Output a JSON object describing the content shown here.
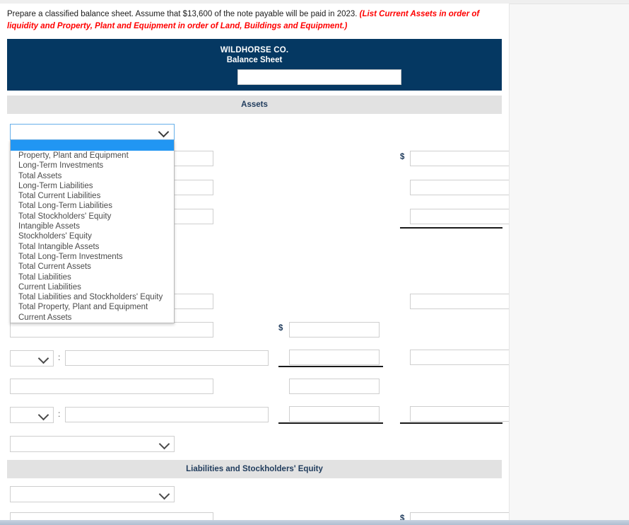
{
  "instructions": {
    "text": "Prepare a classified balance sheet. Assume that $13,600 of the note payable will be paid in 2023. ",
    "hint": "(List Current Assets in order of liquidity and Property, Plant and Equipment in order of Land, Buildings and Equipment.)"
  },
  "sheet": {
    "company": "WILDHORSE CO.",
    "title": "Balance Sheet",
    "period_value": "",
    "period_placeholder": ""
  },
  "sections": {
    "assets": "Assets",
    "liabilities_equity": "Liabilities and Stockholders' Equity"
  },
  "dropdown": {
    "selected": "",
    "options": [
      "",
      "Property, Plant and Equipment",
      "Long-Term Investments",
      "Total Assets",
      "Long-Term Liabilities",
      "Total Current Liabilities",
      "Total Long-Term Liabilities",
      "Total Stockholders' Equity",
      "Intangible Assets",
      "Stockholders' Equity",
      "Total Intangible Assets",
      "Total Long-Term Investments",
      "Total Current Assets",
      "Total Liabilities",
      "Current Liabilities",
      "Total Liabilities and Stockholders' Equity",
      "Total Property, Plant and Equipment",
      "Current Assets"
    ]
  },
  "symbols": {
    "dollar": "$",
    "colon": ":"
  },
  "fields": {
    "label_value": "",
    "amount_value": "",
    "select_value": ""
  },
  "colors": {
    "header_navy": "#053862",
    "band_gray": "#e2e2e2",
    "highlight_blue": "#2196f3",
    "hint_red": "#ff0000"
  }
}
